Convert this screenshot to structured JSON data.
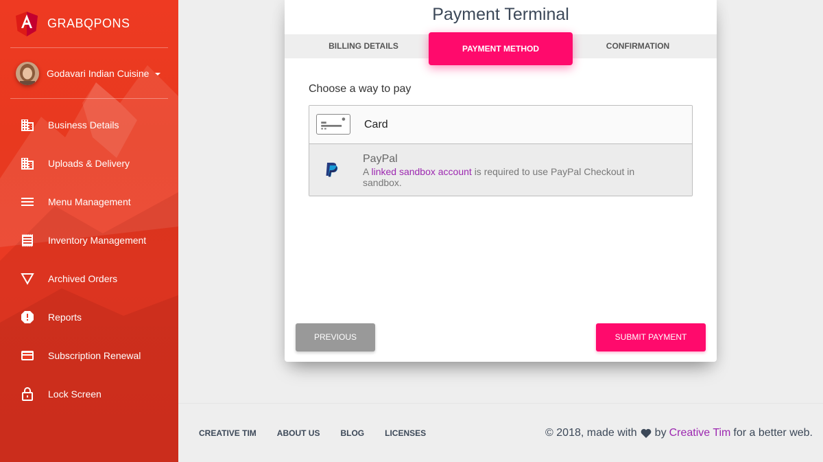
{
  "brand": {
    "name": "GRABQPONS",
    "logo_icon": "angular-logo-icon"
  },
  "user": {
    "name": "Godavari Indian Cuisine"
  },
  "sidebar": {
    "items": [
      {
        "label": "Business Details",
        "icon": "building-icon"
      },
      {
        "label": "Uploads & Delivery",
        "icon": "building-icon"
      },
      {
        "label": "Menu Management",
        "icon": "menu-lines-icon"
      },
      {
        "label": "Inventory Management",
        "icon": "receipt-icon"
      },
      {
        "label": "Archived Orders",
        "icon": "triangle-down-icon"
      },
      {
        "label": "Reports",
        "icon": "alert-icon"
      },
      {
        "label": "Subscription Renewal",
        "icon": "credit-card-icon"
      },
      {
        "label": "Lock Screen",
        "icon": "lock-icon"
      }
    ]
  },
  "card": {
    "title": "Payment Terminal",
    "tabs": [
      {
        "label": "BILLING DETAILS"
      },
      {
        "label": "PAYMENT METHOD",
        "active": true
      },
      {
        "label": "CONFIRMATION"
      }
    ],
    "choose_label": "Choose a way to pay",
    "methods": {
      "card": {
        "label": "Card"
      },
      "paypal": {
        "title": "PayPal",
        "desc_pre": "A",
        "desc_link": "linked sandbox account",
        "desc_post": "is required to use PayPal Checkout in sandbox."
      }
    },
    "buttons": {
      "previous": "PREVIOUS",
      "submit": "SUBMIT PAYMENT"
    }
  },
  "footer": {
    "links": [
      "CREATIVE TIM",
      "ABOUT US",
      "BLOG",
      "LICENSES"
    ],
    "copyright_pre": "© 2018, made with",
    "copyright_by": "by",
    "copyright_link": "Creative Tim",
    "copyright_post": "for a better web."
  },
  "colors": {
    "sidebar": "#ea3a22",
    "accent": "#ff0a6c",
    "link": "#9c27b0",
    "disabled_button": "#999999"
  }
}
